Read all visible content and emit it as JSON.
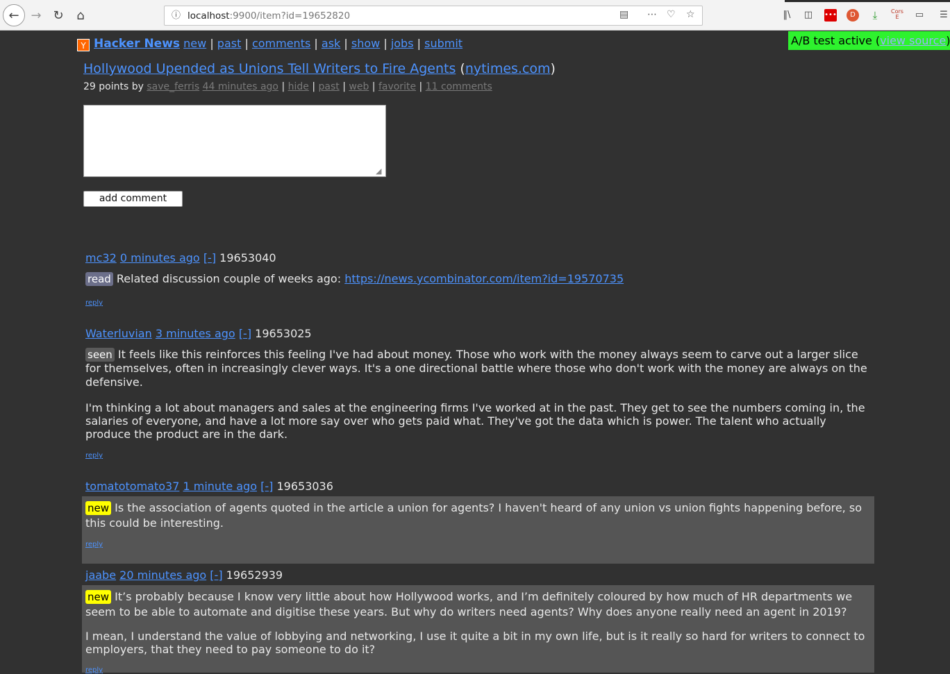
{
  "browser": {
    "url_host": "localhost",
    "url_rest": ":9900/item?id=19652820",
    "icons": {
      "back": "back-arrow-icon",
      "forward": "forward-arrow-icon",
      "reload": "reload-icon",
      "home": "home-icon",
      "info": "info-icon",
      "reader": "reader-view-icon",
      "more": "more-dots-icon",
      "pocket": "pocket-icon",
      "bookmark": "star-icon",
      "library": "library-icon",
      "sidebar": "sidebar-icon",
      "extension_red": "extension-red-icon",
      "duckduckgo": "duckduckgo-icon",
      "download": "download-icon",
      "cors": "cors-extension-icon",
      "page": "page-icon",
      "menu": "hamburger-menu-icon"
    },
    "cors_label": "Cors E"
  },
  "header": {
    "logo_letter": "Y",
    "brand": "Hacker News",
    "nav": [
      "new",
      "past",
      "comments",
      "ask",
      "show",
      "jobs",
      "submit"
    ],
    "separator": "|"
  },
  "ab_badge": {
    "text": "A/B test active (",
    "link": "view source",
    "close": ")"
  },
  "story": {
    "title": "Hollywood Upended as Unions Tell Writers to Fire Agents",
    "domain_open": "(",
    "domain": "nytimes.com",
    "domain_close": ")",
    "points_by": "29 points by",
    "user": "save_ferris",
    "age": "44 minutes ago",
    "links": [
      "hide",
      "past",
      "web",
      "favorite",
      "11 comments"
    ],
    "separator": "|"
  },
  "form": {
    "textarea_value": "",
    "button_label": "add comment"
  },
  "colors": {
    "background": "#313131",
    "link": "#4d93ff",
    "highlight_row": "#555555",
    "tag_new": "#ffff00",
    "tag_read": "#6c6f8a",
    "ab_green": "#2ef22e",
    "logo_orange": "#ff6600"
  },
  "comments": [
    {
      "user": "mc32",
      "age": "0 minutes ago",
      "toggle": "[-]",
      "id": "19653040",
      "tag": "read",
      "paragraphs": [
        "Related discussion couple of weeks ago: "
      ],
      "link": "https://news.ycombinator.com/item?id=19570735",
      "reply": "reply",
      "highlighted": false
    },
    {
      "user": "Waterluvian",
      "age": "3 minutes ago",
      "toggle": "[-]",
      "id": "19653025",
      "tag": "seen",
      "paragraphs": [
        "It feels like this reinforces this feeling I've had about money. Those who work with the money always seem to carve out a larger slice for themselves, often in increasingly clever ways. It's a one directional battle where those who don't work with the money are always on the defensive.",
        "I'm thinking a lot about managers and sales at the engineering firms I've worked at in the past. They get to see the numbers coming in, the salaries of everyone, and have a lot more say over who gets paid what. They've got the data which is power. The talent who actually produce the product are in the dark."
      ],
      "reply": "reply",
      "highlighted": false
    },
    {
      "user": "tomatotomato37",
      "age": "1 minute ago",
      "toggle": "[-]",
      "id": "19653036",
      "tag": "new",
      "paragraphs": [
        "Is the association of agents quoted in the article a union for agents? I haven't heard of any union vs union fights happening before, so this could be interesting."
      ],
      "reply": "reply",
      "highlighted": true
    },
    {
      "user": "jaabe",
      "age": "20 minutes ago",
      "toggle": "[-]",
      "id": "19652939",
      "tag": "new",
      "paragraphs": [
        "It’s probably because I know very little about how Hollywood works, and I’m definitely coloured by how much of HR departments we seem to be able to automate and digitise these years. But why do writers need agents? Why does anyone really need an agent in 2019?",
        "I mean, I understand the value of lobbying and networking, I use it quite a bit in my own life, but is it really so hard for writers to connect to employers, that they need to pay someone to do it?"
      ],
      "reply": "reply",
      "highlighted": true
    }
  ]
}
